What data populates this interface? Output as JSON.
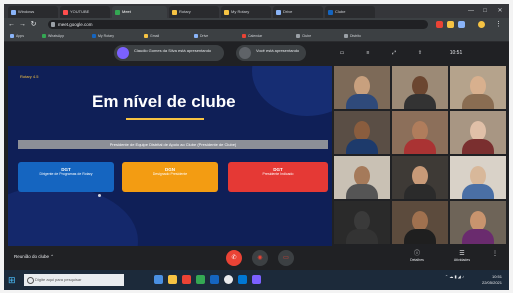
{
  "browser": {
    "tabs": [
      {
        "label": "Windows"
      },
      {
        "label": "YOUTUBE"
      },
      {
        "label": "Meet"
      },
      {
        "label": "Rotary"
      },
      {
        "label": "My Rotary"
      },
      {
        "label": "Drive"
      },
      {
        "label": "Clube"
      }
    ],
    "url": "meet.google.com",
    "bookmarks": [
      "Apps",
      "WhatsApp",
      "My Rotary",
      "Gmail",
      "Drive",
      "Calendar",
      "Clube",
      "Distrito"
    ]
  },
  "meet_top": {
    "presenter_label": "Claudio Gomes da Silva está apresentando",
    "pin_label": "Você está apresentando",
    "controls": [
      "▭",
      "≡",
      "⤢",
      "⇧",
      "10:51"
    ]
  },
  "slide": {
    "tag": "Rotary 4.5",
    "title": "Em nível de clube",
    "banner": "Presidente de Equipe Distrital de Apoio ao Clube (Presidente de Clube)",
    "boxes": [
      {
        "title": "DGT",
        "text": "Dirigente de Programas de Rotary",
        "color": "#1565c0"
      },
      {
        "title": "DGN",
        "text": "Designado Presidente",
        "color": "#f39c12"
      },
      {
        "title": "DGT",
        "text": "Presidente Indicado",
        "color": "#e53935"
      }
    ]
  },
  "meet_bottom": {
    "meeting_name": "Reunião do clube",
    "right_controls": [
      {
        "icon": "ⓘ",
        "label": "Detalhes"
      },
      {
        "icon": "☰",
        "label": "Atividades"
      },
      {
        "icon": "⋮",
        "label": ""
      }
    ]
  },
  "taskbar": {
    "search_placeholder": "Digite aqui para pesquisar",
    "time": "10:51",
    "date": "22/05/2021"
  },
  "colors": {
    "slide_bg": "#0f1f57",
    "accent": "#f6c343",
    "end_call": "#ea4335"
  }
}
